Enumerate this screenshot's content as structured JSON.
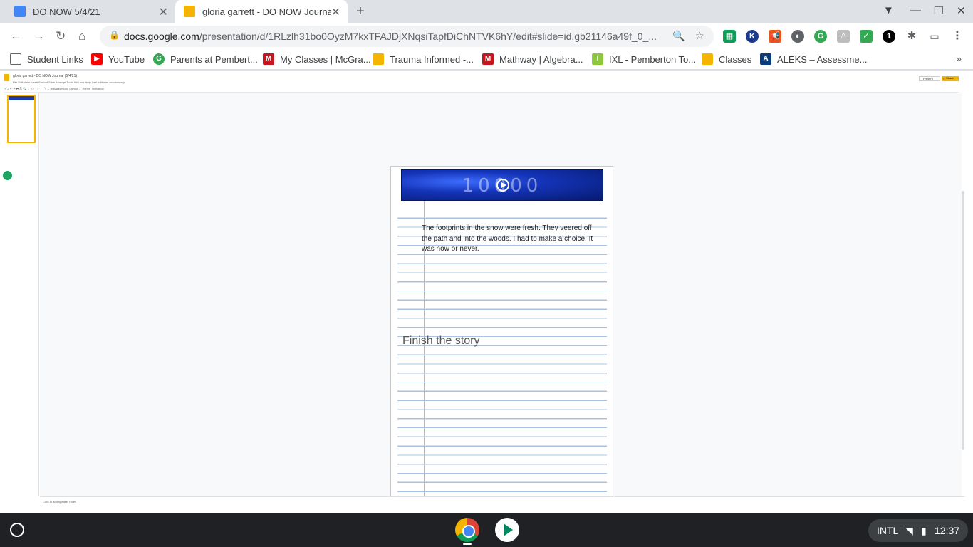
{
  "browser": {
    "tabs": [
      {
        "title": "DO NOW 5/4/21",
        "close": "✕",
        "favicon_color": "#4285f4"
      },
      {
        "title": "gloria garrett - DO NOW Journal",
        "close": "✕",
        "favicon_color": "#f4b400"
      }
    ],
    "new_tab": "+",
    "url_host": "docs.google.com",
    "url_path": "/presentation/d/1RLzlh31bo0OyzM7kxTFAJDjXNqsiTapfDiChNTVK6hY/edit#slide=id.gb21146a49f_0_...",
    "window_controls": {
      "profile": "▼",
      "minimize": "—",
      "restore": "❐",
      "close": "✕"
    }
  },
  "bookmarks": [
    {
      "label": "Student Links",
      "icon": "folder-icon",
      "color": "#5f6368",
      "glyph": ""
    },
    {
      "label": "YouTube",
      "icon": "youtube-icon",
      "color": "#ff0000",
      "glyph": "▶"
    },
    {
      "label": "Parents at Pembert...",
      "icon": "google-icon",
      "color": "#34a853",
      "glyph": "G"
    },
    {
      "label": "My Classes | McGra...",
      "icon": "mcgraw-icon",
      "color": "#c4161c",
      "glyph": "M"
    },
    {
      "label": "Trauma Informed -...",
      "icon": "slides-icon",
      "color": "#f4b400",
      "glyph": ""
    },
    {
      "label": "Mathway | Algebra...",
      "icon": "mathway-icon",
      "color": "#c4161c",
      "glyph": "M"
    },
    {
      "label": "IXL - Pemberton To...",
      "icon": "ixl-icon",
      "color": "#8dc63f",
      "glyph": "I"
    },
    {
      "label": "Classes",
      "icon": "classroom-icon",
      "color": "#f4b400",
      "glyph": ""
    },
    {
      "label": "ALEKS – Assessme...",
      "icon": "aleks-icon",
      "color": "#0a3c7d",
      "glyph": "A"
    }
  ],
  "bookmarks_more": "»",
  "docs": {
    "title": "gloria garrett - DO NOW Journal (5/4/21)",
    "menu": "File   Edit   View   Insert   Format   Slide   Arrange   Tools   Add-ons   Help   Last edit was seconds ago",
    "toolbar": "+  ⌄  ↶  ↷  🖶  ⎘  🔍  ⌄    ↖  ▢  ⬚  ◯  ╲  ⌄   ⊞    Background   Layout ⌄   Theme   Transition",
    "present_label": "▢ Present",
    "share_label": "🔒 Share",
    "notes_placeholder": "Click to add speaker notes"
  },
  "slide": {
    "video_text": "10000",
    "story_text": "The footprints in the snow were fresh. They veered off the path and into the woods. I had to make a choice. It was now or never.",
    "prompt": "Finish the story"
  },
  "shelf": {
    "ime": "INTL",
    "time": "12:37"
  }
}
